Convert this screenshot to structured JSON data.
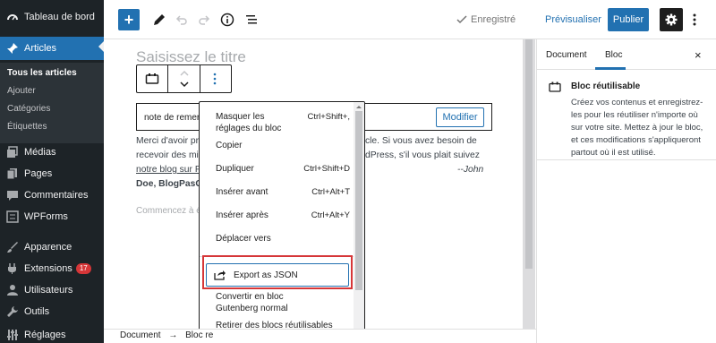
{
  "admin_menu": {
    "dashboard": "Tableau de bord",
    "posts": "Articles",
    "submenu": [
      "Tous les articles",
      "Ajouter",
      "Catégories",
      "Étiquettes"
    ],
    "media": "Médias",
    "pages": "Pages",
    "comments": "Commentaires",
    "wpforms": "WPForms",
    "appearance": "Apparence",
    "extensions": "Extensions",
    "extensions_badge": "17",
    "users": "Utilisateurs",
    "tools": "Outils",
    "settings": "Réglages"
  },
  "top_bar": {
    "saved": "Enregistré",
    "preview": "Prévisualiser",
    "publish": "Publier"
  },
  "editor": {
    "title_placeholder": "Saisissez le titre",
    "block_name": "note de remerc",
    "modify_label": "Modifier",
    "paragraph_lines": [
      "Merci d'avoir pri",
      "recevoir des mis",
      "notre blog sur Fa",
      "Doe, BlogPasCh"
    ],
    "paragraph_right_lines": [
      "cle. Si vous avez besoin de",
      "dPress, s'il vous plait suivez",
      "--John"
    ],
    "placeholder": "Commencez à é"
  },
  "dropdown": {
    "items": [
      {
        "label": "Masquer les réglages du bloc",
        "shortcut": "Ctrl+Shift+,"
      },
      {
        "label": "Copier",
        "shortcut": ""
      },
      {
        "label": "Dupliquer",
        "shortcut": "Ctrl+Shift+D"
      },
      {
        "label": "Insérer avant",
        "shortcut": "Ctrl+Alt+T"
      },
      {
        "label": "Insérer après",
        "shortcut": "Ctrl+Alt+Y"
      },
      {
        "label": "Déplacer vers",
        "shortcut": ""
      }
    ],
    "export_label": "Export as JSON",
    "convert_label": "Convertir en bloc Gutenberg normal",
    "remove_label": "Retirer des blocs réutilisables"
  },
  "footer": {
    "crumb_root": "Document",
    "crumb_arrow": "→",
    "crumb_current": "Bloc re"
  },
  "right_panel": {
    "tab_document": "Document",
    "tab_block": "Bloc",
    "close": "×",
    "card_title": "Bloc réutilisable",
    "card_desc": "Créez vos contenus et enregistrez-les pour les réutiliser n'importe où sur votre site. Mettez à jour le bloc, et ces modifications s'appliqueront partout où il est utilisé."
  },
  "colors": {
    "accent": "#2271b1",
    "highlight": "#d63638",
    "admin_bg": "#1d2327"
  }
}
